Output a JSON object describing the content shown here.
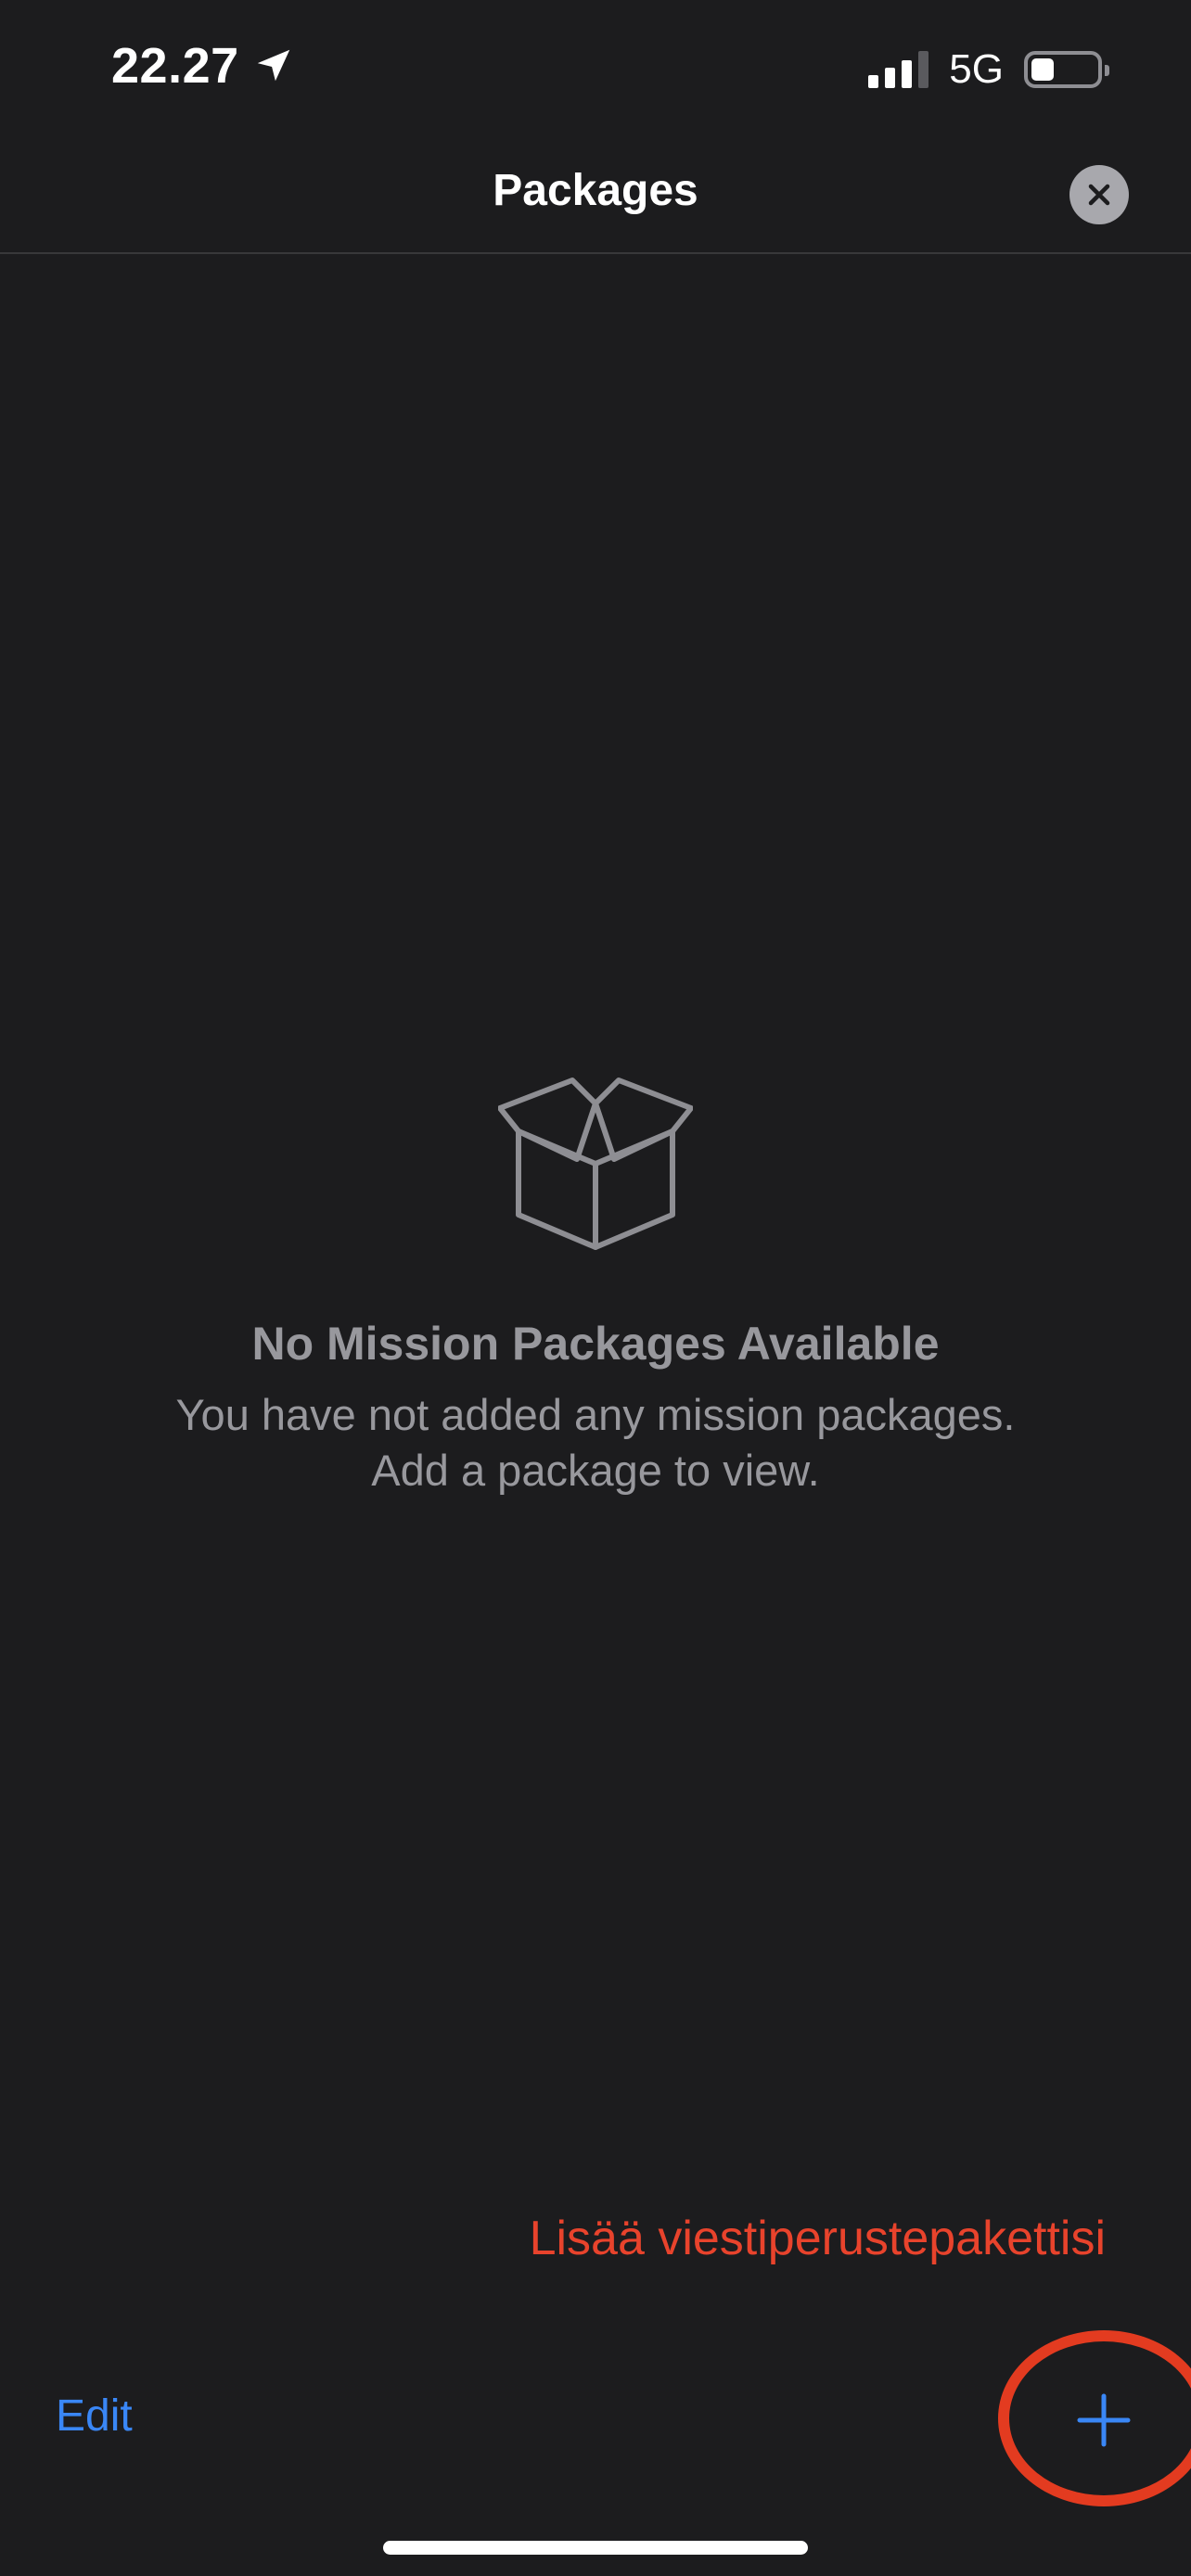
{
  "status_bar": {
    "time": "22.27",
    "network": "5G",
    "icons": {
      "location": "location-arrow-icon",
      "signal": "signal-bars-icon",
      "battery": "battery-icon"
    },
    "signal_bars_active": 3,
    "battery_level": 0.35
  },
  "nav": {
    "title": "Packages",
    "close_icon": "close-icon"
  },
  "empty_state": {
    "icon": "package-box-icon",
    "title": "No Mission Packages Available",
    "message_line1": "You have not added any mission packages.",
    "message_line2": "Add a package to view."
  },
  "annotation": {
    "text": "Lisää viestiperustepakettisi",
    "color": "#e8432c"
  },
  "toolbar": {
    "edit_label": "Edit",
    "add_icon": "plus-icon"
  },
  "colors": {
    "background": "#1c1c1e",
    "accent": "#3a87f6",
    "secondary_text": "#98989d"
  }
}
